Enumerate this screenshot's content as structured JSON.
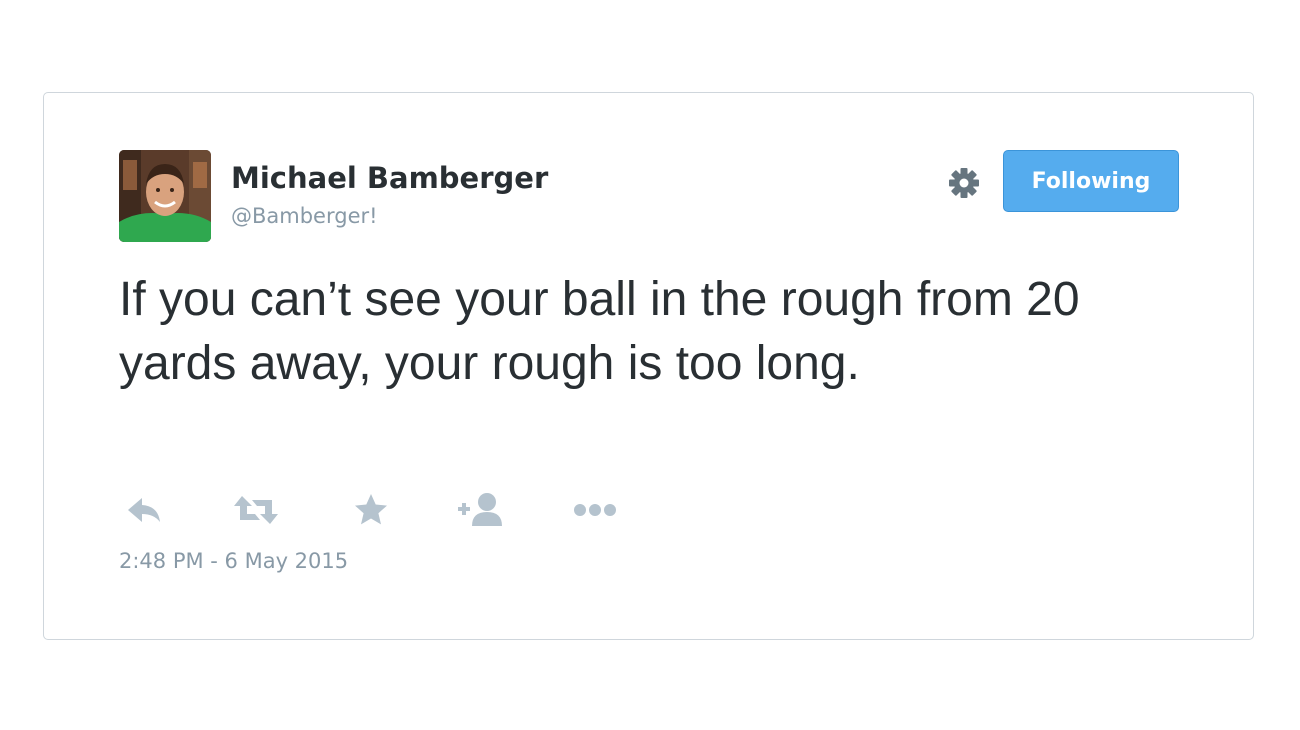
{
  "tweet": {
    "author": {
      "name": "Michael Bamberger",
      "handle": "@Bamberger!"
    },
    "follow_button_label": "Following",
    "text": "If you can’t see your ball in the rough from 20 yards away, your rough is too long.",
    "timestamp": "2:48 PM - 6 May 2015",
    "actions": [
      {
        "icon": "reply-icon"
      },
      {
        "icon": "retweet-icon"
      },
      {
        "icon": "favorite-star-icon"
      },
      {
        "icon": "follow-add-user-icon"
      },
      {
        "icon": "more-dots-icon"
      }
    ],
    "colors": {
      "accent": "#55acee",
      "text": "#292f33",
      "muted": "#8899a6",
      "icon": "#b5c3ce",
      "border": "#cfd6dc"
    }
  }
}
